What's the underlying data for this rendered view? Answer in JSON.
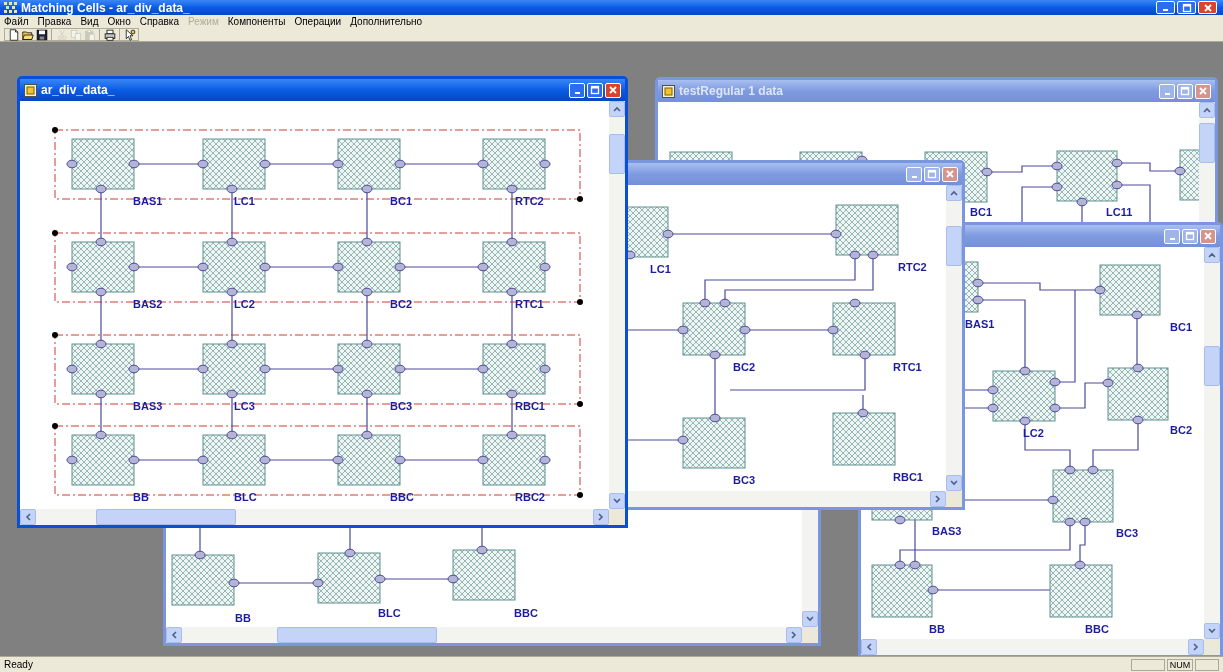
{
  "app": {
    "title": "Matching Cells - ar_div_data_"
  },
  "menu": [
    {
      "label": "Файл",
      "disabled": false
    },
    {
      "label": "Правка",
      "disabled": false
    },
    {
      "label": "Вид",
      "disabled": false
    },
    {
      "label": "Окно",
      "disabled": false
    },
    {
      "label": "Справка",
      "disabled": false
    },
    {
      "label": "Режим",
      "disabled": true
    },
    {
      "label": "Компоненты",
      "disabled": false
    },
    {
      "label": "Операции",
      "disabled": false
    },
    {
      "label": "Дополнительно",
      "disabled": false
    }
  ],
  "toolbar": [
    [
      {
        "kind": "new",
        "disabled": false
      },
      {
        "kind": "open",
        "disabled": false
      },
      {
        "kind": "save",
        "disabled": false
      }
    ],
    [
      {
        "kind": "cut",
        "disabled": true
      },
      {
        "kind": "copy",
        "disabled": true
      },
      {
        "kind": "paste",
        "disabled": true
      }
    ],
    [
      {
        "kind": "print",
        "disabled": false
      }
    ],
    [
      {
        "kind": "help",
        "disabled": false
      }
    ]
  ],
  "windows": [
    {
      "title": "ar_div_data_",
      "active": true,
      "cells": [
        "BAS1",
        "LC1",
        "BC1",
        "RTC2",
        "BAS2",
        "LC2",
        "BC2",
        "RTC1",
        "BAS3",
        "LC3",
        "BC3",
        "RBC1",
        "BB",
        "BLC",
        "BBC",
        "RBC2"
      ]
    },
    {
      "title": "testRegular 1 data",
      "active": false,
      "cells": [
        "BC1",
        "LC11"
      ]
    },
    {
      "active": false,
      "cells": [
        "LC1",
        "RTC2",
        "BC2",
        "RTC1",
        "BC3",
        "RBC1"
      ]
    },
    {
      "active": false,
      "cells": [
        "BAS1",
        "BC1",
        "LC2",
        "BC2",
        "BAS3",
        "BC3",
        "BB",
        "BBC"
      ]
    },
    {
      "cells": [
        "BB",
        "BLC",
        "BBC"
      ]
    }
  ],
  "status_bar": {
    "text": "Ready",
    "indicators": [
      "NUM"
    ]
  }
}
